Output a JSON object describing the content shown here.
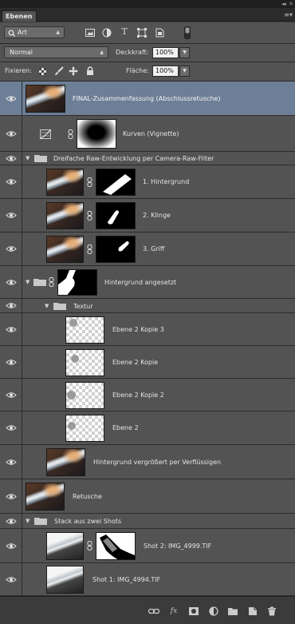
{
  "window": {
    "collapse_glyph": "◂◂",
    "close_glyph": "✕"
  },
  "tabs": {
    "active_label": "Ebenen",
    "panel_menu_icon": "≡▾"
  },
  "filter": {
    "kind_label": "Art",
    "icons": [
      "search-icon",
      "image-filter-icon",
      "adjustment-filter-icon",
      "type-filter-icon",
      "shape-filter-icon",
      "smart-object-filter-icon",
      "filter-toggle-switch"
    ]
  },
  "blend": {
    "mode_value": "Normal",
    "opacity_label": "Deckkraft:",
    "opacity_value": "100%"
  },
  "lock": {
    "label": "Fixieren:",
    "fill_label": "Fläche:",
    "fill_value": "100%",
    "icons": [
      "lock-transparent-pixels-icon",
      "lock-image-pixels-icon",
      "lock-position-icon",
      "lock-all-icon"
    ]
  },
  "layers": [
    {
      "name": "FINAL-Zusammenfassung (Abschlussretusche)",
      "type": "image",
      "selected": true
    },
    {
      "name": "Kurven  (Vignette)",
      "type": "adjustment"
    },
    {
      "name": "Dreifache Raw-Entwicklung per Camera-Raw-Filter",
      "type": "group"
    },
    {
      "name": "1. Hintergrund",
      "type": "masked-image"
    },
    {
      "name": "2. Klinge",
      "type": "masked-image"
    },
    {
      "name": "3. Griff",
      "type": "masked-image"
    },
    {
      "name": "Hintergrund angesetzt",
      "type": "masked-group"
    },
    {
      "name": "Textur",
      "type": "group"
    },
    {
      "name": "Ebene 2 Kopie 3",
      "type": "transparent"
    },
    {
      "name": "Ebene 2 Kopie",
      "type": "transparent"
    },
    {
      "name": "Ebene 2 Kopie 2",
      "type": "transparent"
    },
    {
      "name": "Ebene 2",
      "type": "transparent"
    },
    {
      "name": "Hintergrund vergrößert per Verflüssigen",
      "type": "image"
    },
    {
      "name": "Retusche",
      "type": "image"
    },
    {
      "name": "Stack aus zwei Shots",
      "type": "group"
    },
    {
      "name": "Shot 2: IMG_4999.TIF",
      "type": "masked-image"
    },
    {
      "name": "Shot 1: IMG_4994.TIF",
      "type": "image"
    }
  ],
  "footer": {
    "icons": [
      "link-layers-icon",
      "fx-icon",
      "add-mask-icon",
      "adjustment-layer-icon",
      "new-group-icon",
      "new-layer-icon",
      "trash-icon"
    ],
    "fx_label": "fx"
  }
}
